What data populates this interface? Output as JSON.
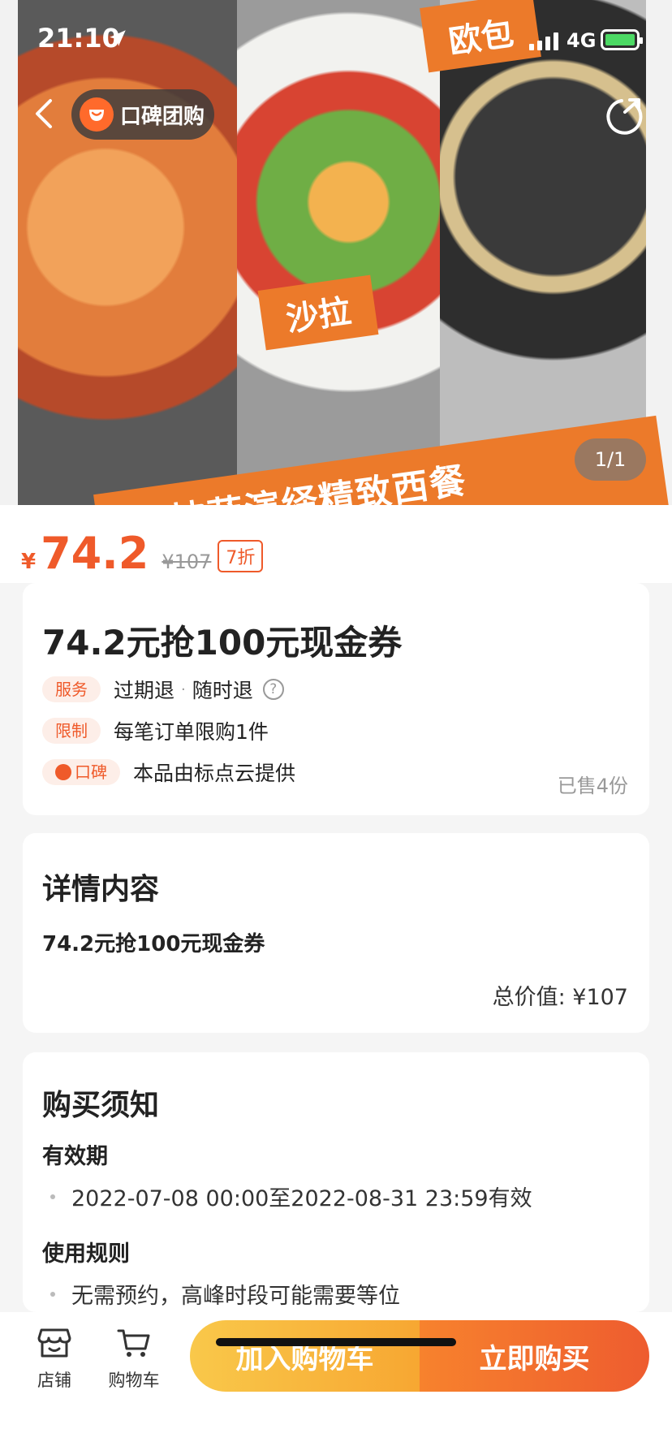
{
  "status_bar": {
    "time": "21:10",
    "network": "4G"
  },
  "hero": {
    "brand": "口碑团购",
    "tags": {
      "salad": "沙拉",
      "bread": "欧包"
    },
    "banner": "披萨演绎精致西餐",
    "page_indicator": "1/1"
  },
  "price": {
    "currency": "¥",
    "current": "74.2",
    "original": "¥107",
    "discount": "7折"
  },
  "deal": {
    "title": "74.2元抢100元现金券",
    "service_label": "服务",
    "service_text_1": "过期退",
    "service_sep": "·",
    "service_text_2": "随时退",
    "help_icon": "?",
    "limit_label": "限制",
    "limit_text": "每笔订单限购1件",
    "koubei_label": "口碑",
    "provider_text": "本品由标点云提供",
    "sold": "已售4份"
  },
  "details": {
    "title": "详情内容",
    "line": "74.2元抢100元现金券",
    "total": "总价值: ¥107"
  },
  "notice": {
    "title": "购买须知",
    "validity_title": "有效期",
    "validity_text": "2022-07-08 00:00至2022-08-31 23:59有效",
    "rules_title": "使用规则",
    "rules_text": "无需预约，高峰时段可能需要等位"
  },
  "bottom_bar": {
    "shop_label": "店铺",
    "cart_label": "购物车",
    "add_cart": "加入购物车",
    "buy_now": "立即购买"
  },
  "colors": {
    "accent": "#ef5a2a",
    "cart_button": "#f7a732",
    "buy_button": "#ee5c2f"
  }
}
